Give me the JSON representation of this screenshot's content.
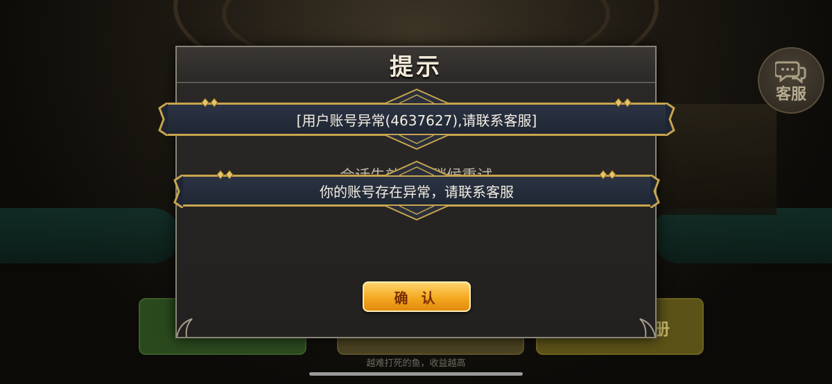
{
  "dialog": {
    "title": "提示",
    "message": "会话失效，请稍候重试",
    "confirm_label": "确 认"
  },
  "toasts": [
    {
      "text": "[用户账号异常(4637627),请联系客服]"
    },
    {
      "text": "你的账号存在异常，请联系客服"
    }
  ],
  "support": {
    "label": "客服",
    "icon": "chat-bubbles-icon"
  },
  "background": {
    "side_glyph": "册",
    "slogan": "越难打死的鱼，收益越高"
  },
  "colors": {
    "button_gold": "#f4a821",
    "toast_border": "#c9a54e",
    "dialog_bg": "#2a2826"
  }
}
